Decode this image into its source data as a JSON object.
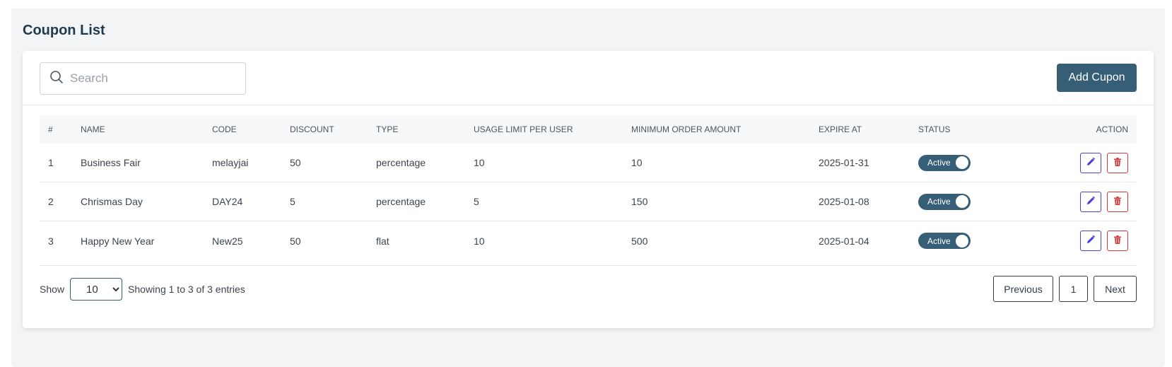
{
  "page": {
    "title": "Coupon List"
  },
  "search": {
    "placeholder": "Search"
  },
  "toolbar": {
    "add_label": "Add Cupon"
  },
  "table": {
    "headers": [
      "#",
      "NAME",
      "CODE",
      "DISCOUNT",
      "TYPE",
      "USAGE LIMIT PER USER",
      "MINIMUM ORDER AMOUNT",
      "EXPIRE AT",
      "STATUS",
      "ACTION"
    ],
    "rows": [
      {
        "index": "1",
        "name": "Business Fair",
        "code": "melayjai",
        "discount": "50",
        "type": "percentage",
        "usage_limit": "10",
        "min_order": "10",
        "expire_at": "2025-01-31",
        "status": "Active"
      },
      {
        "index": "2",
        "name": "Chrismas Day",
        "code": "DAY24",
        "discount": "5",
        "type": "percentage",
        "usage_limit": "5",
        "min_order": "150",
        "expire_at": "2025-01-08",
        "status": "Active"
      },
      {
        "index": "3",
        "name": "Happy New Year",
        "code": "New25",
        "discount": "50",
        "type": "flat",
        "usage_limit": "10",
        "min_order": "500",
        "expire_at": "2025-01-04",
        "status": "Active"
      }
    ]
  },
  "footer": {
    "show_label": "Show",
    "page_size": "10",
    "page_size_options": [
      "10"
    ],
    "entries_text": "Showing 1 to 3 of 3 entries",
    "previous_label": "Previous",
    "current_page": "1",
    "next_label": "Next"
  },
  "icons": {
    "search": "search-icon",
    "edit": "pencil-icon",
    "delete": "trash-icon"
  },
  "colors": {
    "primary": "#375e77",
    "edit": "#4b3fd6",
    "delete": "#d3393a"
  }
}
